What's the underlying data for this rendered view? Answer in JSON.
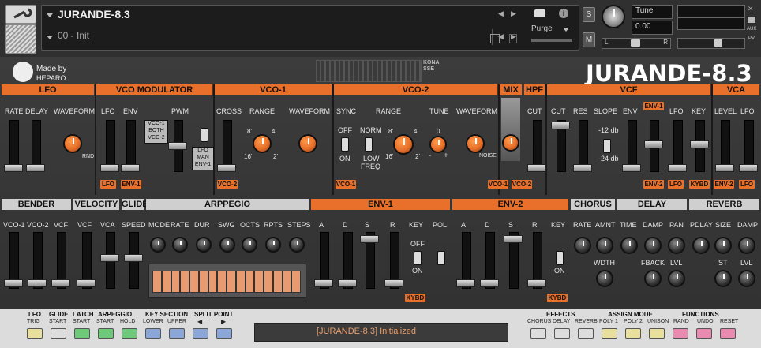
{
  "header": {
    "instrument_name": "JURANDE-8.3",
    "snapshot": "00 - Init",
    "output": "Purge",
    "tune_label": "Tune",
    "tune_value": "0.00",
    "solo": "S",
    "mute": "M",
    "pan_left": "L",
    "pan_right": "R",
    "aux": "AUX",
    "pv": "PV"
  },
  "brand": {
    "made_by": "Made by",
    "maker": "HEPARO",
    "logo": "KONASSE",
    "title": "JURANDE-8.3"
  },
  "sections_top": {
    "lfo": "LFO",
    "vco_mod": "VCO MODULATOR",
    "vco1": "VCO-1",
    "vco2": "VCO-2",
    "mix": "MIX",
    "hpf": "HPF",
    "vcf": "VCF",
    "vca": "VCA"
  },
  "lfo": {
    "rate": "RATE",
    "delay": "DELAY",
    "waveform": "WAVEFORM",
    "rnd": "RND"
  },
  "vcomod": {
    "lfo": "LFO",
    "env": "ENV",
    "pwm": "PWM",
    "opts": [
      "VCO-1",
      "BOTH",
      "VCO-2"
    ],
    "src": [
      "LFO",
      "MAN",
      "ENV-1"
    ],
    "tag_lfo": "LFO",
    "tag_env": "ENV-1"
  },
  "vco1": {
    "cross": "CROSS",
    "range": "RANGE",
    "waveform": "WAVEFORM",
    "r8": "8'",
    "r4": "4'",
    "r16": "16'",
    "r2": "2'",
    "tag": "VCO-2"
  },
  "vco2": {
    "sync": "SYNC",
    "range": "RANGE",
    "norm": "NORM",
    "low": "LOW",
    "freq": "FREQ",
    "tune": "TUNE",
    "waveform": "WAVEFORM",
    "off": "OFF",
    "on": "ON",
    "r8": "8'",
    "r4": "4'",
    "r16": "16'",
    "r2": "2'",
    "zero": "0",
    "minus": "-",
    "plus": "+",
    "noise": "NOISE",
    "tag": "VCO-1"
  },
  "mix": {
    "tag1": "VCO-1",
    "tag2": "VCO-2"
  },
  "hpf": {
    "cut": "CUT"
  },
  "vcf": {
    "cut": "CUT",
    "res": "RES",
    "slope": "SLOPE",
    "s12": "-12 db",
    "s24": "-24 db",
    "env": "ENV",
    "lfo": "LFO",
    "key": "KEY",
    "tag_env_top": "ENV-1",
    "tag_env": "ENV-2",
    "tag_lfo": "LFO",
    "tag_kybd": "KYBD"
  },
  "vca": {
    "level": "LEVEL",
    "lfo": "LFO",
    "tag_env": "ENV-2",
    "tag_lfo": "LFO"
  },
  "sections_bottom": {
    "bender": "BENDER",
    "velocity": "VELOCITY",
    "glide": "GLIDE",
    "arp": "ARPPEGIO",
    "env1": "ENV-1",
    "env2": "ENV-2",
    "chorus": "CHORUS",
    "delay": "DELAY",
    "reverb": "REVERB"
  },
  "bender": {
    "vco1": "VCO-1",
    "vco2": "VCO-2",
    "vcf": "VCF"
  },
  "velocity": {
    "vcf": "VCF",
    "vca": "VCA"
  },
  "glide": {
    "speed": "SPEED"
  },
  "arp": {
    "mode": "MODE",
    "rate": "RATE",
    "dur": "DUR",
    "swg": "SWG",
    "octs": "OCTS",
    "rpts": "RPTS",
    "steps": "STEPS"
  },
  "env1": {
    "a": "A",
    "d": "D",
    "s": "S",
    "r": "R",
    "key": "KEY",
    "pol": "POL",
    "off": "OFF",
    "on": "ON",
    "tag": "KYBD"
  },
  "env2": {
    "a": "A",
    "d": "D",
    "s": "S",
    "r": "R",
    "key": "KEY",
    "off": "OFF",
    "on": "ON",
    "tag": "KYBD"
  },
  "chorus": {
    "rate": "RATE",
    "amnt": "AMNT",
    "wdth": "WDTH"
  },
  "delay": {
    "time": "TIME",
    "damp": "DAMP",
    "pan": "PAN",
    "fback": "FBACK",
    "lvl": "LVL"
  },
  "reverb": {
    "pdlay": "PDLAY",
    "size": "SIZE",
    "damp": "DAMP",
    "st": "ST",
    "lvl": "LVL"
  },
  "footer": {
    "groups": [
      "LFO",
      "GLIDE",
      "LATCH",
      "ARPEGGIO",
      "KEY SECTION",
      "SPLIT POINT"
    ],
    "labels": [
      "TRIG",
      "START",
      "START",
      "START",
      "HOLD",
      "LOWER",
      "UPPER",
      "◀",
      "▶"
    ],
    "status": "[JURANDE-8.3] Initialized",
    "effects": "EFFECTS",
    "assign": "ASSIGN MODE",
    "functions": "FUNCTIONS",
    "right_labels": [
      "CHORUS",
      "DELAY",
      "REVERB",
      "POLY 1",
      "POLY 2",
      "UNISON",
      "RAND",
      "UNDO",
      "RESET"
    ]
  },
  "colors": {
    "accent": "#e8702a",
    "section_grey": "#cfcfcf",
    "panel": "#3a3a3a"
  }
}
